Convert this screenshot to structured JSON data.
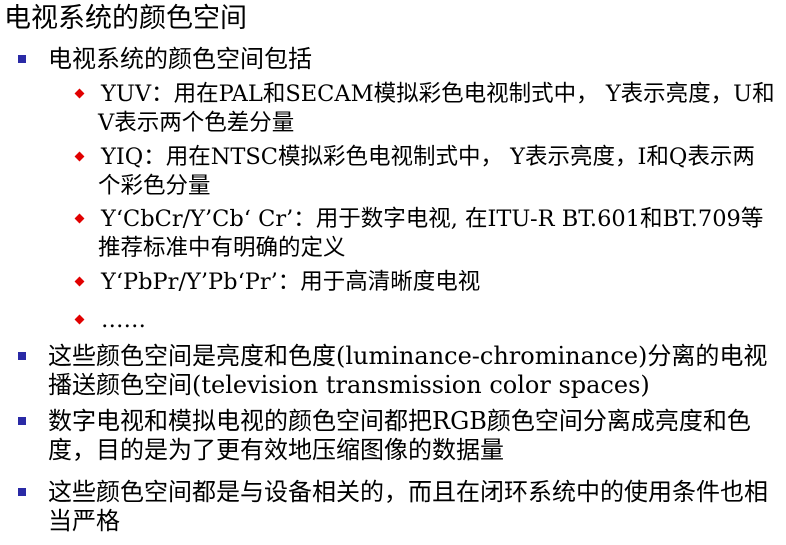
{
  "title": "电视系统的颜色空间",
  "colors": {
    "bullet_square": "#2a2aa6",
    "bullet_diamond": "#e10000"
  },
  "items": [
    {
      "text": "电视系统的颜色空间包括",
      "subitems": [
        {
          "text": "YUV：用在PAL和SECAM模拟彩色电视制式中， Y表示亮度，U和V表示两个色差分量"
        },
        {
          "text": " YIQ：用在NTSC模拟彩色电视制式中， Y表示亮度，I和Q表示两个彩色分量"
        },
        {
          "text": "Y‘CbCr/Y’Cb‘ Cr’：用于数字电视, 在ITU-R BT.601和BT.709等推荐标准中有明确的定义"
        },
        {
          "text": "Y‘PbPr/Y’Pb‘Pr’：用于高清晰度电视"
        },
        {
          "text": "……"
        }
      ]
    },
    {
      "text": "这些颜色空间是亮度和色度(luminance-chrominance)分离的电视播送颜色空间(television transmission color spaces)"
    },
    {
      "text": "数字电视和模拟电视的颜色空间都把RGB颜色空间分离成亮度和色度，目的是为了更有效地压缩图像的数据量"
    },
    {
      "text": "这些颜色空间都是与设备相关的，而且在闭环系统中的使用条件也相当严格"
    }
  ]
}
